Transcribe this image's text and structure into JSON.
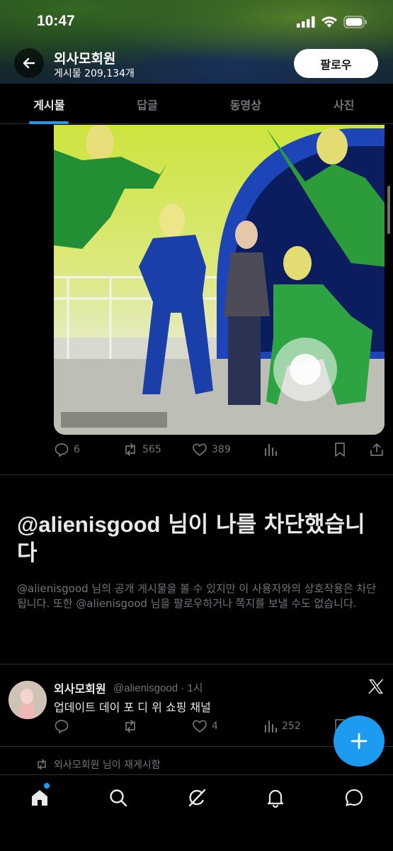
{
  "status_bar": {
    "time": "10:47"
  },
  "profile": {
    "name": "외사모회원",
    "post_count": "게시물 209,134개",
    "follow_label": "팔로우"
  },
  "tabs": [
    {
      "label": "게시물",
      "active": true
    },
    {
      "label": "답글",
      "active": false
    },
    {
      "label": "동영상",
      "active": false
    },
    {
      "label": "사진",
      "active": false
    }
  ],
  "post1": {
    "replies": "6",
    "reposts": "565",
    "likes": "389"
  },
  "blocked": {
    "handle": "@alienisgood",
    "title_rest": " 님이 나를 차단했습니다",
    "description": "@alienisgood 님의 공개 게시물을 볼 수 있지만 이 사용자와의 상호작용은 차단됩니다. 또한 @alienisgood 님을 팔로우하거나 쪽지를 보낼 수도 없습니다."
  },
  "post2": {
    "name": "외사모회원",
    "meta": "@alienisgood · 1시",
    "text": "업데이트 데이 포 디 위 쇼핑 채널",
    "likes": "4",
    "views": "252"
  },
  "repost_notice": "외사모회원 님이 재게시함",
  "colors": {
    "accent": "#1d9bf0",
    "muted": "#71767b",
    "text": "#e7e9ea",
    "divider": "#2f3336"
  },
  "icons": [
    "back-arrow-icon",
    "reply-icon",
    "repost-icon",
    "like-icon",
    "views-icon",
    "bookmark-icon",
    "share-icon",
    "x-logo-icon",
    "plus-icon",
    "home-icon",
    "search-icon",
    "grok-icon",
    "notifications-icon",
    "messages-icon"
  ]
}
